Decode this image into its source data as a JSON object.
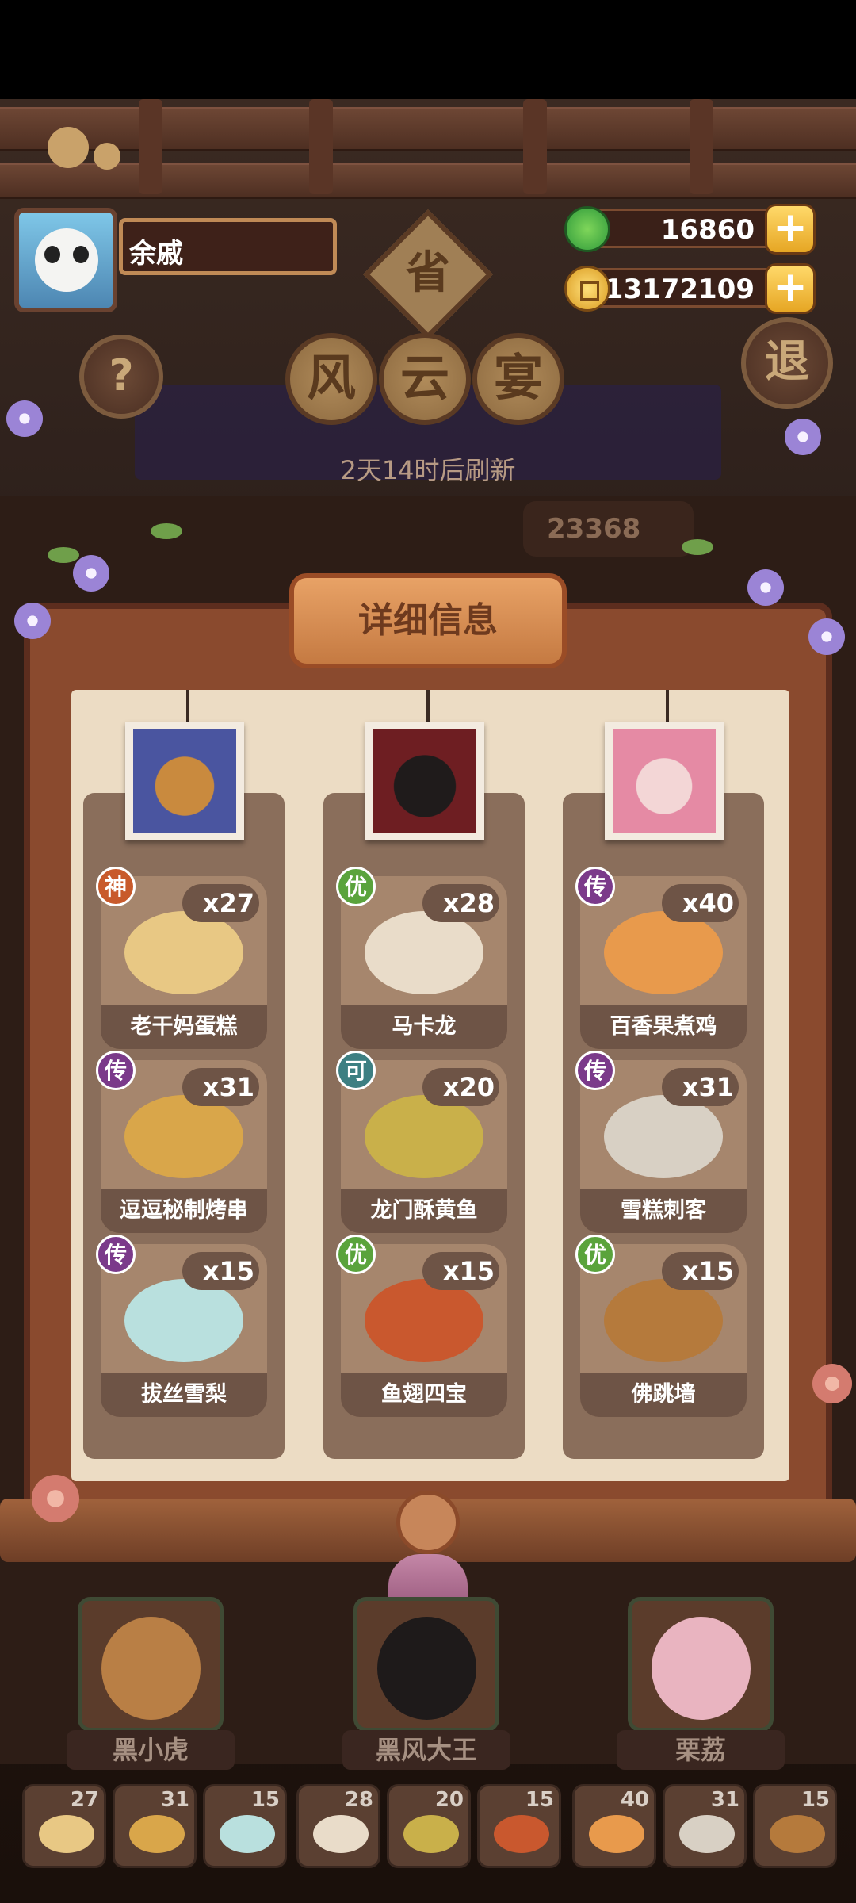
{
  "player": {
    "name": "余戚"
  },
  "resources": [
    {
      "icon": "green-jade-icon",
      "value": "16860",
      "color": "#3fb24a"
    },
    {
      "icon": "gold-coin-icon",
      "value": "13172109",
      "color": "#e2a726"
    }
  ],
  "title_chars": [
    "省",
    "风",
    "云",
    "宴"
  ],
  "help_button": "?",
  "exit_button": "退",
  "refresh_text": "2天14时后刷新",
  "score_text": "23368",
  "panel_title": "详细信息",
  "columns": [
    {
      "portrait": "bear-icon",
      "dishes": [
        {
          "badge": "神",
          "badge_color": "#c85a2b",
          "count": "x27",
          "name": "老干妈蛋糕",
          "food_color": "#e8c884"
        },
        {
          "badge": "传",
          "badge_color": "#7b3a8a",
          "count": "x31",
          "name": "逗逗秘制烤串",
          "food_color": "#d9a64a"
        },
        {
          "badge": "传",
          "badge_color": "#7b3a8a",
          "count": "x15",
          "name": "拔丝雪梨",
          "food_color": "#b9e0de"
        }
      ]
    },
    {
      "portrait": "black-bear-icon",
      "dishes": [
        {
          "badge": "优",
          "badge_color": "#5aa33c",
          "count": "x28",
          "name": "马卡龙",
          "food_color": "#e9dcc9"
        },
        {
          "badge": "可",
          "badge_color": "#3d7f82",
          "count": "x20",
          "name": "龙门酥黄鱼",
          "food_color": "#c9b04a"
        },
        {
          "badge": "优",
          "badge_color": "#5aa33c",
          "count": "x15",
          "name": "鱼翅四宝",
          "food_color": "#c9582e"
        }
      ]
    },
    {
      "portrait": "pink-girl-icon",
      "dishes": [
        {
          "badge": "传",
          "badge_color": "#7b3a8a",
          "count": "x40",
          "name": "百香果煮鸡",
          "food_color": "#e89a4c"
        },
        {
          "badge": "传",
          "badge_color": "#7b3a8a",
          "count": "x31",
          "name": "雪糕刺客",
          "food_color": "#d8d0c4"
        },
        {
          "badge": "优",
          "badge_color": "#5aa33c",
          "count": "x15",
          "name": "佛跳墙",
          "food_color": "#b57a3c"
        }
      ]
    }
  ],
  "heroes": [
    {
      "name": "黑小虎",
      "face_color": "#b97f45"
    },
    {
      "name": "黑风大王",
      "face_color": "#1e1a1a"
    },
    {
      "name": "栗荔",
      "face_color": "#e9b4c0"
    }
  ],
  "mini_counts": [
    {
      "count": "27",
      "food_color": "#e8c884"
    },
    {
      "count": "31",
      "food_color": "#d9a64a"
    },
    {
      "count": "15",
      "food_color": "#b9e0de"
    },
    {
      "count": "28",
      "food_color": "#e9dcc9"
    },
    {
      "count": "20",
      "food_color": "#c9b04a"
    },
    {
      "count": "15",
      "food_color": "#c9582e"
    },
    {
      "count": "40",
      "food_color": "#e89a4c"
    },
    {
      "count": "31",
      "food_color": "#d8d0c4"
    },
    {
      "count": "15",
      "food_color": "#b57a3c"
    }
  ]
}
